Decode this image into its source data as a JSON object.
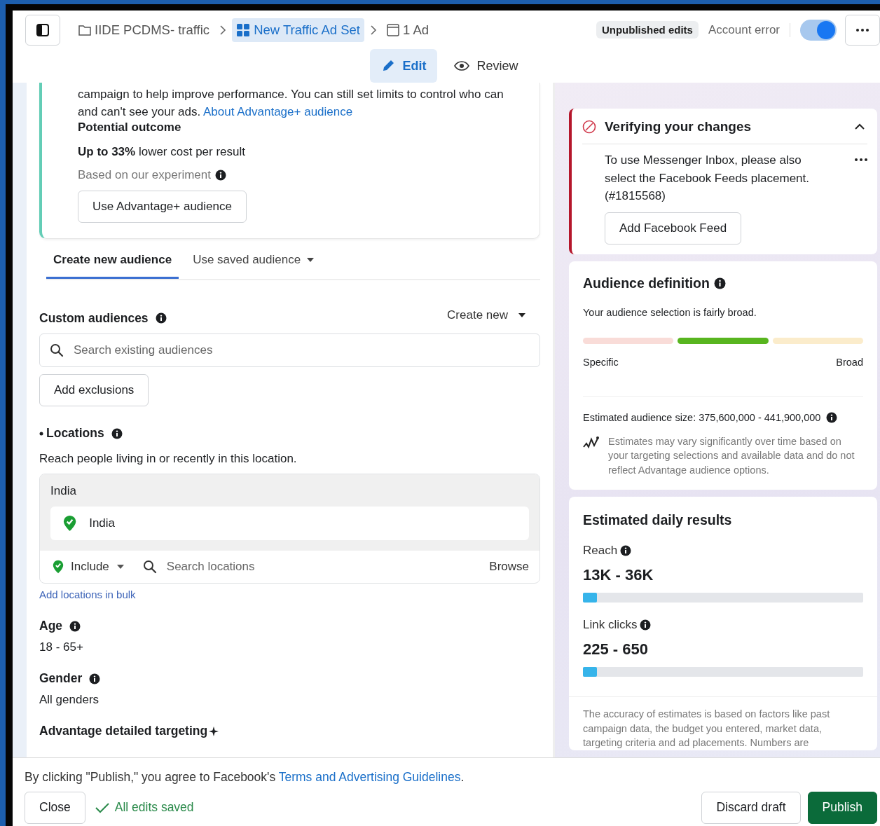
{
  "topbar": {
    "breadcrumbs": [
      {
        "label": "IIDE PCDMS- traffic",
        "kind": "campaign",
        "selected": false
      },
      {
        "label": "New Traffic Ad Set",
        "kind": "adset",
        "selected": true
      },
      {
        "label": "1 Ad",
        "kind": "ad",
        "selected": false
      }
    ],
    "status_badge": "Unpublished edits",
    "account_status": "Account error",
    "toggle": {
      "on": true
    }
  },
  "mode_tabs": [
    {
      "label": "Edit",
      "kind": "edit",
      "selected": true
    },
    {
      "label": "Review",
      "kind": "review",
      "selected": false
    }
  ],
  "advantage_card": {
    "description": "campaign to help improve performance. You can still set limits to control who can and can't see your ads.",
    "link": "About Advantage+ audience",
    "outcome_title": "Potential outcome",
    "outcome": "**Up to 33%** lower cost per result",
    "note": "Based on our experiment",
    "button": "Use Advantage+ audience"
  },
  "audience_tabs": [
    {
      "label": "Create new audience",
      "selected": true,
      "dropdown": false
    },
    {
      "label": "Use saved audience",
      "selected": false,
      "dropdown": true
    }
  ],
  "custom_audiences": {
    "title": "Custom audiences",
    "create_new": "Create new",
    "search_placeholder": "Search existing audiences",
    "exclusions_button": "Add exclusions"
  },
  "locations": {
    "title": "Locations",
    "required": true,
    "description": "Reach people living in or recently in this location.",
    "group_title": "India",
    "items": [
      {
        "label": "India"
      }
    ],
    "include": "Include",
    "search_placeholder": "Search locations",
    "browse": "Browse",
    "bulk_link": "Add locations in bulk"
  },
  "age": {
    "title": "Age",
    "value": "18 - 65+"
  },
  "gender": {
    "title": "Gender",
    "value": "All genders"
  },
  "detailed_targeting": {
    "title": "Advantage detailed targeting"
  },
  "verification": {
    "title": "Verifying your changes",
    "expanded": true,
    "message": "To use Messenger Inbox, please also select the Facebook Feeds placement. (#1815568)",
    "button": "Add Facebook Feed"
  },
  "audience_definition": {
    "title": "Audience definition",
    "summary": "Your audience selection is fairly broad.",
    "segments": [
      {
        "color": "#f9dcd8"
      },
      {
        "color": "#58b51f"
      },
      {
        "color": "#fbeccb"
      }
    ],
    "min_label": "Specific",
    "max_label": "Broad",
    "size": "Estimated audience size: 375,600,000 - 441,900,000",
    "disclaimer": "Estimates may vary significantly over time based on your targeting selections and available data and do not reflect Advantage audience options."
  },
  "daily_results": {
    "title": "Estimated daily results",
    "metrics": [
      {
        "label": "Reach",
        "value": "13K - 36K",
        "level": 0.05
      },
      {
        "label": "Link clicks",
        "value": "225 - 650",
        "level": 0.05
      }
    ],
    "note": "The accuracy of estimates is based on factors like past campaign data, the budget you entered, market data, targeting criteria and ad placements. Numbers are"
  },
  "footer": {
    "agreement": "By clicking \"Publish,\" you agree to Facebook's",
    "link": "Terms and Advertising Guidelines",
    "agreement_end": ".",
    "close": "Close",
    "saved": "All edits saved",
    "discard": "Discard draft",
    "publish": "Publish"
  }
}
